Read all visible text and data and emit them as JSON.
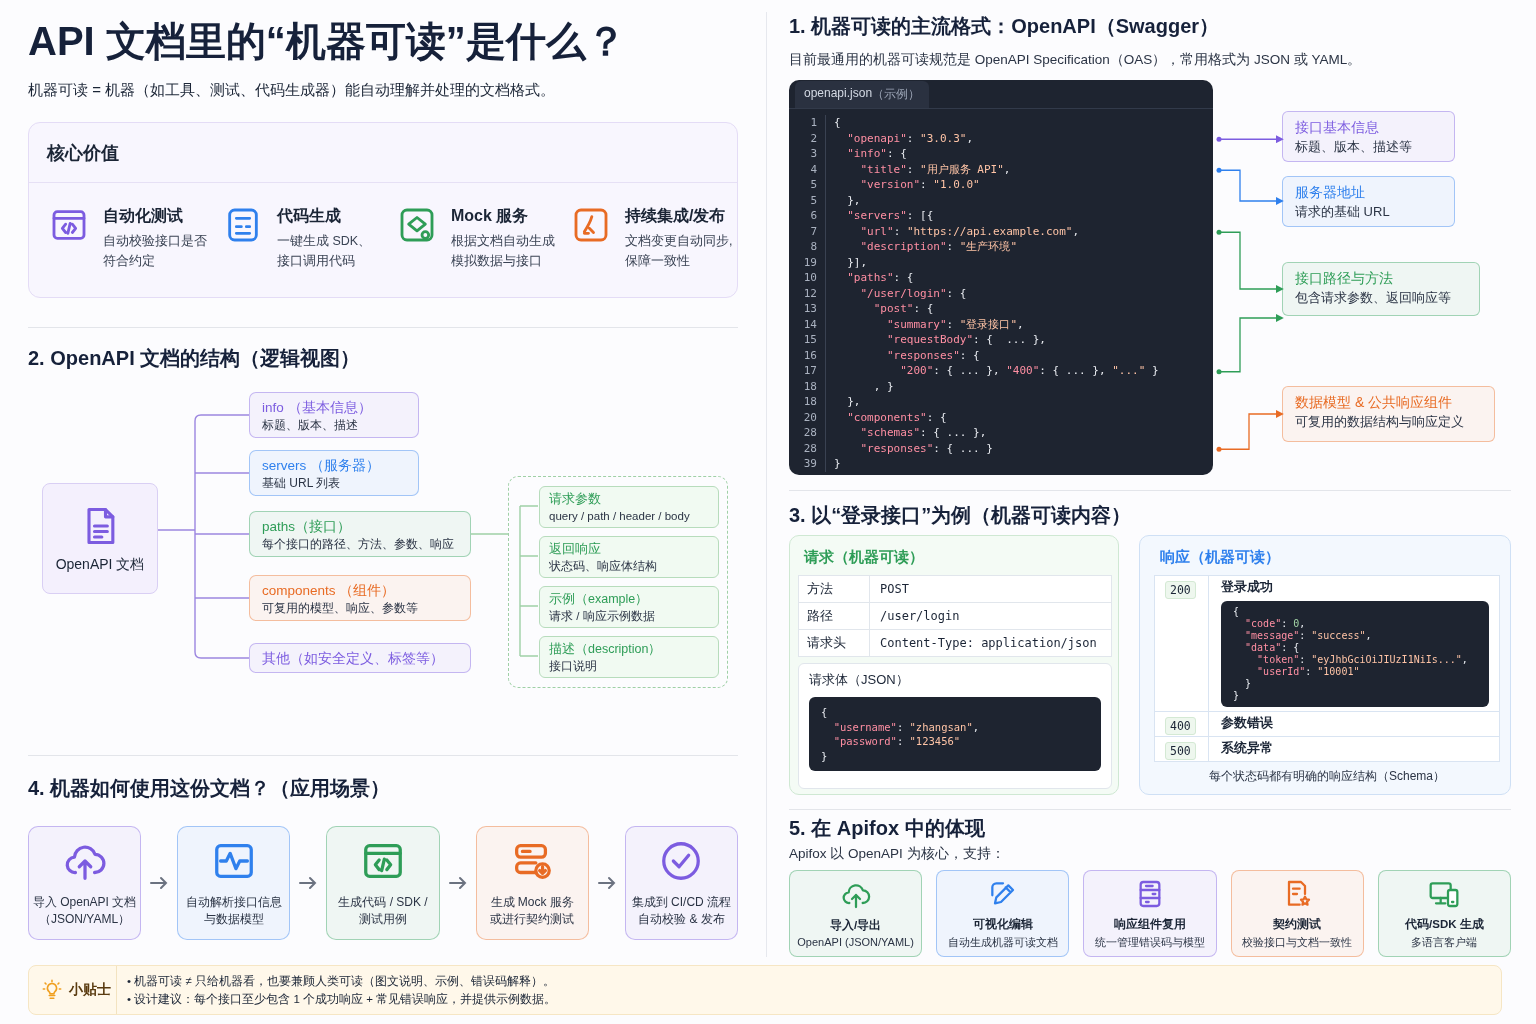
{
  "title": "API 文档里的“机器可读”是什么？",
  "subtitle": "机器可读 = 机器（如工具、测试、代码生成器）能自动理解并处理的文档格式。",
  "core_value": {
    "title": "核心价值",
    "items": [
      {
        "title": "自动化测试",
        "description": [
          "自动校验接口是否",
          "符合约定"
        ],
        "color": "#7c5ce0"
      },
      {
        "title": "代码生成",
        "description": [
          "一键生成 SDK、",
          "接口调用代码"
        ],
        "color": "#2f80ed"
      },
      {
        "title": "Mock 服务",
        "description": [
          "根据文档自动生成",
          "模拟数据与接口"
        ],
        "color": "#2e9d57"
      },
      {
        "title": "持续集成/发布",
        "description": [
          "文档变更自动同步,",
          "保障一致性"
        ],
        "color": "#e86b24"
      }
    ]
  },
  "structure": {
    "title": "2. OpenAPI 文档的结构（逻辑视图）",
    "root": "OpenAPI 文档",
    "branches": [
      {
        "title": "info （基本信息）",
        "description": "标题、版本、描述",
        "color": "#7c5ce0"
      },
      {
        "title": "servers （服务器）",
        "description": "基础 URL 列表",
        "color": "#2f80ed"
      },
      {
        "title": "paths（接口）",
        "description": "每个接口的路径、方法、参数、响应",
        "color": "#2e9d57",
        "children": [
          {
            "title": "请求参数",
            "description": "query / path / header / body"
          },
          {
            "title": "返回响应",
            "description": "状态码、响应体结构"
          },
          {
            "title": "示例（example）",
            "description": "请求 / 响应示例数据"
          },
          {
            "title": "描述（description）",
            "description": "接口说明"
          }
        ]
      },
      {
        "title": "components （组件）",
        "description": "可复用的模型、响应、参数等",
        "color": "#e86b24"
      },
      {
        "title": "其他（如安全定义、标签等）",
        "color": "#7c5ce0"
      }
    ]
  },
  "usage": {
    "title": "4. 机器如何使用这份文档？（应用场景）",
    "steps": [
      {
        "label": [
          "导入 OpenAPI 文档",
          "（JSON/YAML）"
        ],
        "color": "#7c5ce0"
      },
      {
        "label": [
          "自动解析接口信息",
          "与数据模型"
        ],
        "color": "#2f80ed"
      },
      {
        "label": [
          "生成代码 / SDK /",
          "测试用例"
        ],
        "color": "#2e9d57"
      },
      {
        "label": [
          "生成 Mock 服务",
          "或进行契约测试"
        ],
        "color": "#e86b24"
      },
      {
        "label": [
          "集成到 CI/CD 流程",
          "自动校验 & 发布"
        ],
        "color": "#7c5ce0"
      }
    ]
  },
  "format": {
    "title": "1. 机器可读的主流格式：OpenAPI（Swagger）",
    "description": "目前最通用的机器可读规范是 OpenAPI Specification（OAS），常用格式为 JSON 或 YAML。",
    "code": {
      "tab": "openapi.json",
      "tab_note": "（示例）",
      "lines": [
        {
          "num": "1",
          "code": "{"
        },
        {
          "num": "2",
          "code": "  \"openapi\": \"3.0.3\","
        },
        {
          "num": "3",
          "code": "  \"info\": {"
        },
        {
          "num": "4",
          "code": "    \"title\": \"用户服务 API\","
        },
        {
          "num": "5",
          "code": "    \"version\": \"1.0.0\""
        },
        {
          "num": "5",
          "code": "  },"
        },
        {
          "num": "6",
          "code": "  \"servers\": [{"
        },
        {
          "num": "7",
          "code": "    \"url\": \"https://api.example.com\","
        },
        {
          "num": "8",
          "code": "    \"description\": \"生产环境\""
        },
        {
          "num": "19",
          "code": "  }],"
        },
        {
          "num": "10",
          "code": "  \"paths\": {"
        },
        {
          "num": "12",
          "code": "    \"/user/login\": {"
        },
        {
          "num": "13",
          "code": "      \"post\": {"
        },
        {
          "num": "14",
          "code": "        \"summary\": \"登录接口\","
        },
        {
          "num": "15",
          "code": "        \"requestBody\": {  ... },"
        },
        {
          "num": "16",
          "code": "        \"responses\": {"
        },
        {
          "num": "17",
          "code": "          \"200\": { ... }, \"400\": { ... }, \"...\" }"
        },
        {
          "num": "18",
          "code": "      , }"
        },
        {
          "num": "18",
          "code": "  },"
        },
        {
          "num": "20",
          "code": "  \"components\": {"
        },
        {
          "num": "28",
          "code": "    \"schemas\": { ... },"
        },
        {
          "num": "28",
          "code": "    \"responses\": { ... }"
        },
        {
          "num": "39",
          "code": "}"
        }
      ]
    },
    "callouts": [
      {
        "title": "接口基本信息",
        "description": "标题、版本、描述等",
        "color": "#7c5ce0"
      },
      {
        "title": "服务器地址",
        "description": "请求的基础 URL",
        "color": "#2f80ed"
      },
      {
        "title": "接口路径与方法",
        "description": "包含请求参数、返回响应等",
        "color": "#2e9d57"
      },
      {
        "title": "数据模型 & 公共响应组件",
        "description": "可复用的数据结构与响应定义",
        "color": "#e86b24"
      }
    ]
  },
  "example": {
    "title": "3. 以“登录接口”为例（机器可读内容）",
    "request": {
      "title": "请求（机器可读）",
      "fields": [
        {
          "label": "方法",
          "value": "POST"
        },
        {
          "label": "路径",
          "value": "/user/login"
        },
        {
          "label": "请求头",
          "value": "Content-Type: application/json"
        }
      ],
      "body_label": "请求体（JSON）",
      "body": [
        "{",
        "  \"username\": \"zhangsan\",",
        "  \"password\": \"123456\"",
        "}"
      ]
    },
    "response": {
      "title": "响应（机器可读）",
      "statuses": [
        {
          "code": "200",
          "label": "登录成功",
          "body": [
            "{",
            "  \"code\": 0,",
            "  \"message\": \"success\",",
            "  \"data\": {",
            "    \"token\": \"eyJhbGciOiJIUzI1NiIs...\",",
            "    \"userId\": \"10001\"",
            "  }",
            "}"
          ]
        },
        {
          "code": "400",
          "label": "参数错误"
        },
        {
          "code": "500",
          "label": "系统异常"
        }
      ],
      "note": "每个状态码都有明确的响应结构（Schema）"
    }
  },
  "apifox": {
    "title": "5. 在 Apifox 中的体现",
    "description": "Apifox 以 OpenAPI 为核心，支持：",
    "features": [
      {
        "title": "导入/导出",
        "description": "OpenAPI (JSON/YAML)",
        "color": "#2e9d57"
      },
      {
        "title": "可视化编辑",
        "description": "自动生成机器可读文档",
        "color": "#2f80ed"
      },
      {
        "title": "响应组件复用",
        "description": "统一管理错误码与模型",
        "color": "#7c5ce0"
      },
      {
        "title": "契约测试",
        "description": "校验接口与文档一致性",
        "color": "#e86b24"
      },
      {
        "title": "代码/SDK 生成",
        "description": "多语言客户端",
        "color": "#2e9d57"
      }
    ]
  },
  "tip": {
    "title": "小贴士",
    "points": [
      "• 机器可读 ≠ 只给机器看，也要兼顾人类可读（图文说明、示例、错误码解释）。",
      "• 设计建议：每个接口至少包含 1 个成功响应 + 常见错误响应，并提供示例数据。"
    ]
  }
}
